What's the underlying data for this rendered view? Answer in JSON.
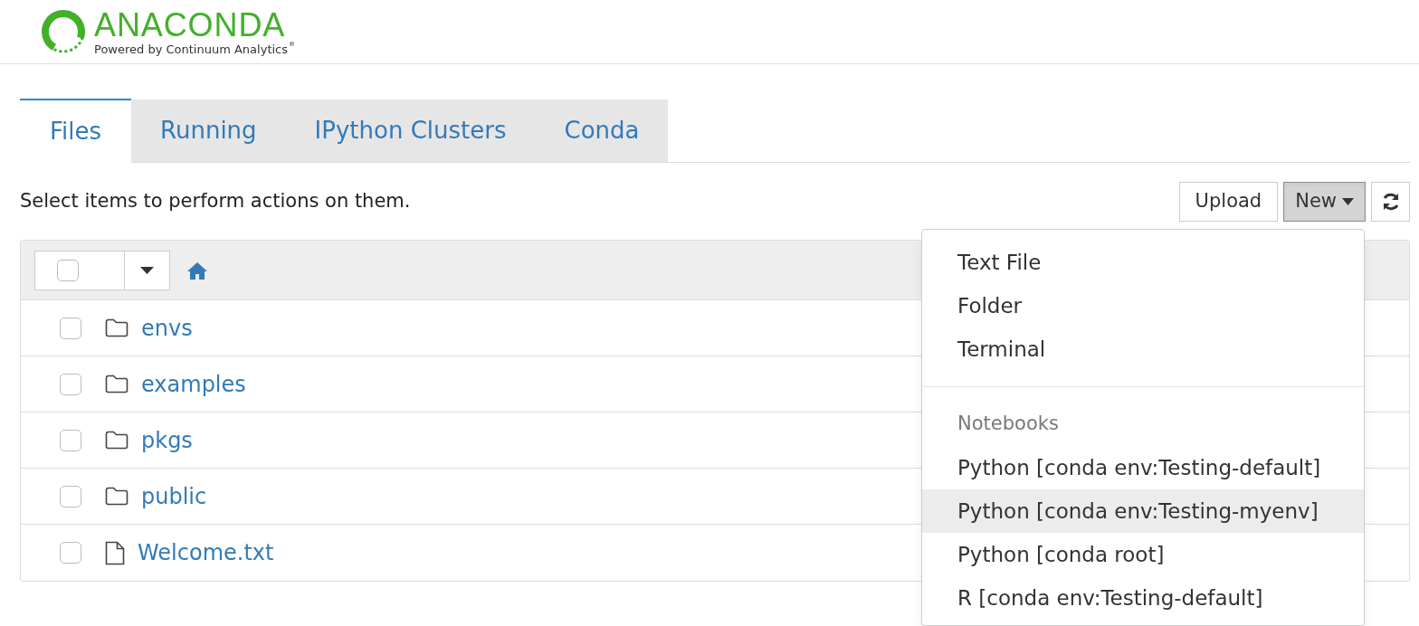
{
  "logo": {
    "name": "ANACONDA",
    "tagline": "Powered by Continuum Analytics",
    "mark": "®"
  },
  "tabs": [
    {
      "label": "Files",
      "selected": true
    },
    {
      "label": "Running",
      "selected": false
    },
    {
      "label": "IPython Clusters",
      "selected": false
    },
    {
      "label": "Conda",
      "selected": false
    }
  ],
  "hint": "Select items to perform actions on them.",
  "toolbar": {
    "upload": "Upload",
    "new": {
      "label": "New",
      "pressed": true
    }
  },
  "file_list": {
    "select_all_checked": false,
    "rows": [
      {
        "kind": "folder",
        "name": "envs",
        "checked": false
      },
      {
        "kind": "folder",
        "name": "examples",
        "checked": false
      },
      {
        "kind": "folder",
        "name": "pkgs",
        "checked": false
      },
      {
        "kind": "folder",
        "name": "public",
        "checked": false
      },
      {
        "kind": "file",
        "name": "Welcome.txt",
        "checked": false
      }
    ]
  },
  "new_menu": {
    "items": [
      {
        "kind": "item",
        "label": "Text File",
        "highlighted": false
      },
      {
        "kind": "item",
        "label": "Folder",
        "highlighted": false
      },
      {
        "kind": "item",
        "label": "Terminal",
        "highlighted": false
      },
      {
        "kind": "divider"
      },
      {
        "kind": "header",
        "label": "Notebooks"
      },
      {
        "kind": "item",
        "label": "Python [conda env:Testing-default]",
        "highlighted": false
      },
      {
        "kind": "item",
        "label": "Python [conda env:Testing-myenv]",
        "highlighted": true
      },
      {
        "kind": "item",
        "label": "Python [conda root]",
        "highlighted": false
      },
      {
        "kind": "item",
        "label": "R [conda env:Testing-default]",
        "highlighted": false
      }
    ]
  }
}
